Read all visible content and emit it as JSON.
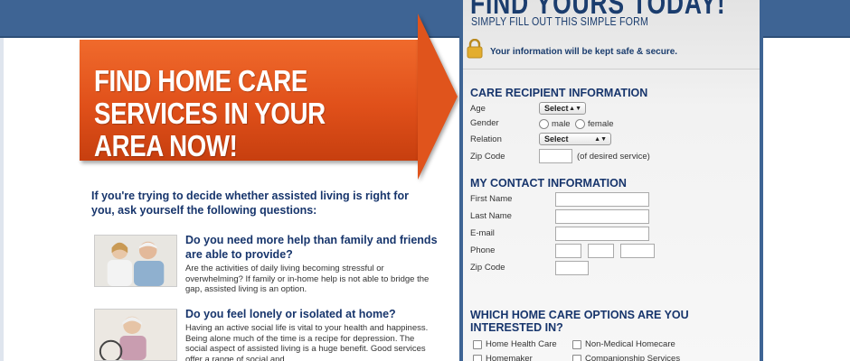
{
  "banner": {
    "title": "FIND HOME CARE SERVICES IN YOUR AREA NOW!"
  },
  "intro": "If you're trying to decide whether assisted living is right for you, ask yourself the following questions:",
  "questions": [
    {
      "question": "Do you need more help than family and friends are able to provide?",
      "answer": "Are the activities of daily living becoming stressful or overwhelming? If family or in-home help is not able to bridge the gap, assisted living is an option."
    },
    {
      "question": "Do you feel lonely or isolated at home?",
      "answer": "Having an active social life is vital to your health and happiness. Being alone much of the time is a recipe for depression. The social aspect of assisted living is a huge benefit. Good services offer a range of social and"
    }
  ],
  "form": {
    "headline": "FIND YOURS TODAY!",
    "subheadline": "SIMPLY FILL OUT THIS SIMPLE FORM",
    "secure_note": "Your information will be kept safe & secure.",
    "recipient": {
      "heading": "CARE RECIPIENT INFORMATION",
      "age_label": "Age",
      "age_value": "Select",
      "gender_label": "Gender",
      "gender_options": [
        "male",
        "female"
      ],
      "relation_label": "Relation",
      "relation_value": "Select",
      "zip_label": "Zip Code",
      "zip_note": "(of desired service)"
    },
    "contact": {
      "heading": "MY CONTACT INFORMATION",
      "first_name_label": "First Name",
      "last_name_label": "Last Name",
      "email_label": "E-mail",
      "phone_label": "Phone",
      "zip_label": "Zip Code"
    },
    "options": {
      "heading_line1": "WHICH HOME CARE OPTIONS ARE YOU",
      "heading_line2": "INTERESTED IN?",
      "items": [
        "Home Health Care",
        "Non-Medical Homecare",
        "Homemaker",
        "Companionship Services"
      ]
    }
  },
  "colors": {
    "header_blue": "#3e6494",
    "banner_orange": "#e0501a",
    "heading_navy": "#17356c"
  }
}
